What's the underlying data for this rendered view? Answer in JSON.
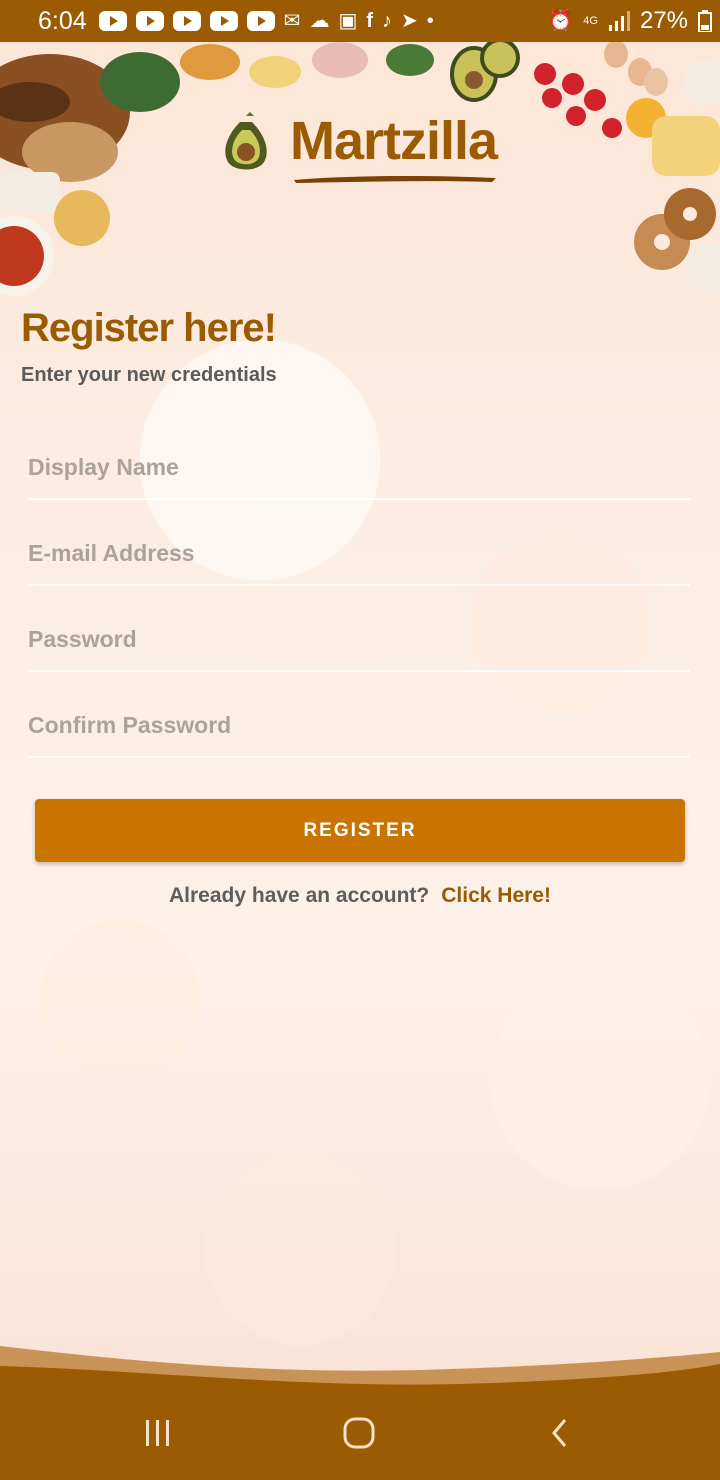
{
  "status_bar": {
    "time": "6:04",
    "network": "4G",
    "battery": "27%",
    "icons": [
      "youtube-icon",
      "youtube-icon",
      "youtube-icon",
      "youtube-icon",
      "youtube-icon",
      "mail-icon",
      "cloud-icon",
      "photos-icon",
      "facebook-icon",
      "tiktok-icon",
      "telegram-icon",
      "dot-icon",
      "alarm-icon",
      "signal-icon",
      "battery-icon"
    ]
  },
  "brand": {
    "name": "Martzilla"
  },
  "header": {
    "title": "Register here!",
    "subtitle": "Enter your new credentials"
  },
  "form": {
    "display_name_placeholder": "Display Name",
    "email_placeholder": "E-mail Address",
    "password_placeholder": "Password",
    "confirm_password_placeholder": "Confirm Password",
    "register_label": "REGISTER"
  },
  "footer": {
    "already_text": "Already have an account?",
    "link_text": "Click Here!"
  },
  "colors": {
    "primary": "#9a5b02",
    "button": "#ca7400",
    "text_muted": "#5e5e5e"
  }
}
